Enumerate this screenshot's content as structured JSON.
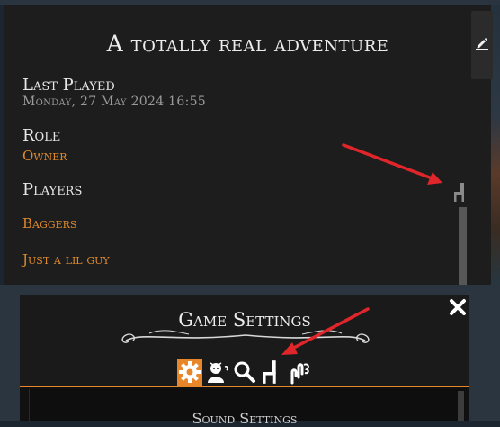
{
  "adventure": {
    "title": "A totally real adventure",
    "last_played_label": "Last Played",
    "last_played_value": "Monday, 27 May 2024 16:55",
    "role_label": "Role",
    "role_value": "Owner",
    "players_label": "Players",
    "players": [
      "Baggers",
      "Just a lil guy"
    ],
    "edit_icon": "pencil-icon",
    "player_icon": "chair-icon"
  },
  "settings": {
    "title": "Game Settings",
    "close_icon": "close-icon",
    "tabs": [
      {
        "icon": "gear-icon",
        "active": true
      },
      {
        "icon": "character-icon",
        "active": false
      },
      {
        "icon": "magnifier-icon",
        "active": false
      },
      {
        "icon": "chair-icon",
        "active": false
      },
      {
        "icon": "hand-gesture-icon",
        "active": false
      }
    ],
    "section_heading": "Sound Settings"
  },
  "colors": {
    "accent": "#e8862a",
    "annotation": "#e0262a",
    "panel": "#1d1d1d"
  }
}
